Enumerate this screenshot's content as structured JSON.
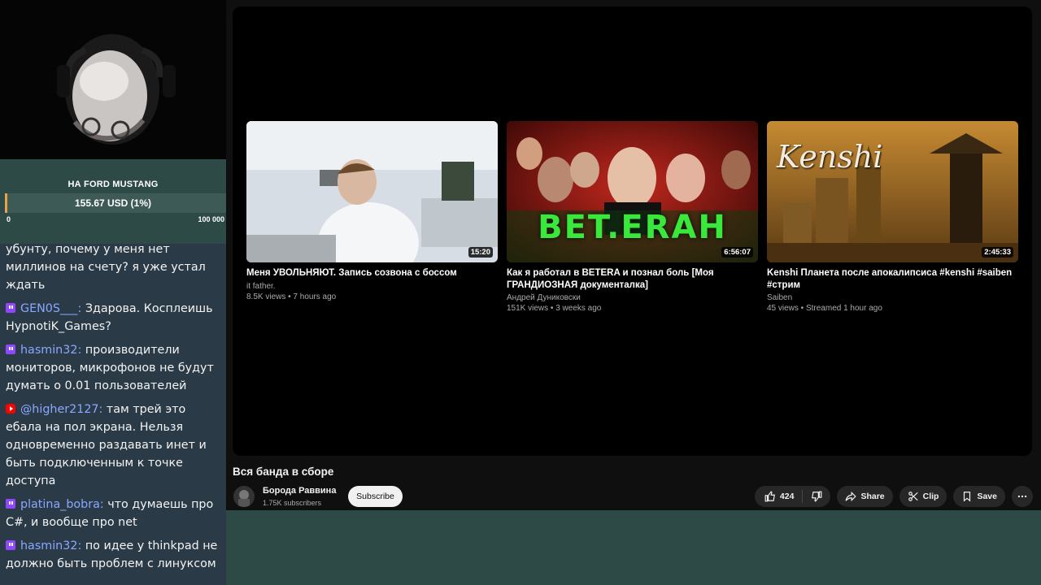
{
  "goal": {
    "title": "НА FORD MUSTANG",
    "amount": "155.67 USD (1%)",
    "min": "0",
    "max": "100 000",
    "progress_fraction": 0.01,
    "accent_color": "#e8a24a"
  },
  "chat": {
    "messages": [
      {
        "platform": "",
        "user": "",
        "text": "убунту, почему у меня нет миллинов на счету? я уже устал ждать"
      },
      {
        "platform": "twitch",
        "user": "GEN0S___",
        "text": "Здарова. Косплеишь HypnotiK_Games?"
      },
      {
        "platform": "twitch",
        "user": "hasmin32",
        "text": "производители мониторов, микрофонов не будут думать о 0.01 пользователей"
      },
      {
        "platform": "youtube",
        "user": "@higher2127",
        "text": "там трей это ебала на пол экрана. Нельзя одновременно раздавать инет и быть подключенным к точке доступа"
      },
      {
        "platform": "twitch",
        "user": "platina_bobra",
        "text": "что думаешь про C#, и вообще про net"
      },
      {
        "platform": "twitch",
        "user": "hasmin32",
        "text": "по идее у thinkpad не должно быть проблем с линуксом"
      }
    ]
  },
  "end_screen": {
    "videos": [
      {
        "title": "Меня УВОЛЬНЯЮТ. Запись созвона с боссом",
        "channel": "it father.",
        "meta": "8.5K views • 7 hours ago",
        "duration": "15:20"
      },
      {
        "title": "Как я работал в BETERA и познал боль [Моя ГРАНДИОЗНАЯ документалка]",
        "channel": "Андрей Дуниковски",
        "meta": "151K views • 3 weeks ago",
        "duration": "6:56:07",
        "thumb_text": "BET.ERAH"
      },
      {
        "title": "Kenshi Планета после апокалипсиса #kenshi #saiben #стрим",
        "channel": "Saiben",
        "meta": "45 views • Streamed 1 hour ago",
        "duration": "2:45:33",
        "thumb_text": "Kenshi"
      }
    ]
  },
  "video": {
    "title": "Вся банда в сборе",
    "channel": "Борода Раввина",
    "subscribers": "1.75K subscribers",
    "subscribe_label": "Subscribe",
    "likes": "424",
    "share_label": "Share",
    "clip_label": "Clip",
    "save_label": "Save"
  },
  "icons": [
    "thumbs-up-icon",
    "thumbs-down-icon",
    "share-icon",
    "scissors-icon",
    "bookmark-icon",
    "more-icon",
    "twitch-icon",
    "youtube-icon"
  ]
}
